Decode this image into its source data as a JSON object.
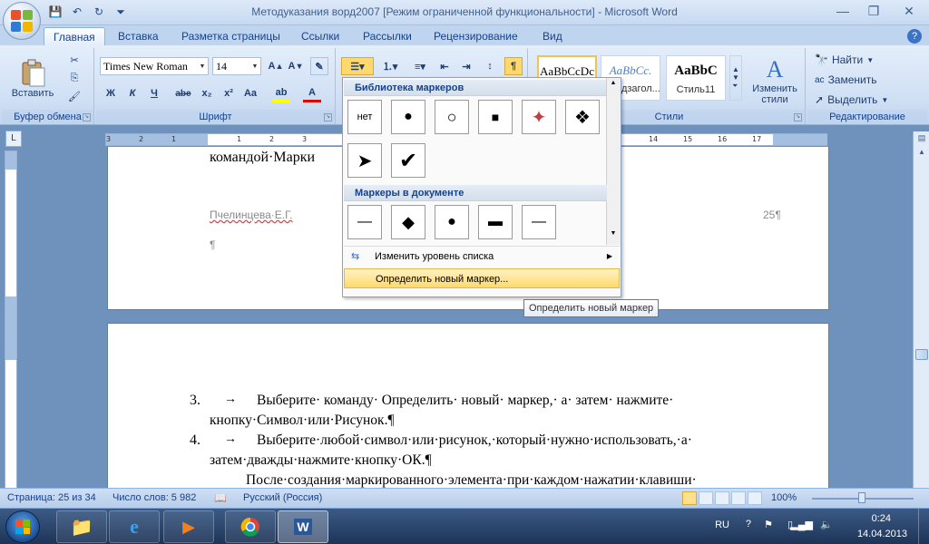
{
  "window": {
    "title": "Методуказания  ворд2007 [Режим ограниченной функциональности] - Microsoft Word"
  },
  "tabs": [
    "Главная",
    "Вставка",
    "Разметка страницы",
    "Ссылки",
    "Рассылки",
    "Рецензирование",
    "Вид"
  ],
  "ribbon": {
    "clipboard": {
      "label": "Буфер обмена",
      "paste_label": "Вставить"
    },
    "font": {
      "label": "Шрифт",
      "font_name": "Times New Roman",
      "font_size": "14",
      "bold": "Ж",
      "italic": "К",
      "underline": "Ч",
      "strike": "abe",
      "subscript": "x₂",
      "superscript": "x²",
      "case": "Aa"
    },
    "styles": {
      "label": "Стили",
      "items": [
        {
          "sample": "AaBbCcDc",
          "name": ""
        },
        {
          "sample": "AaBbCc.",
          "name": "¶ Подзагол..."
        },
        {
          "sample": "AaBbC",
          "name": "Стиль11"
        }
      ],
      "change_styles": "Изменить стили"
    },
    "editing": {
      "label": "Редактирование",
      "find": "Найти",
      "replace": "Заменить",
      "select": "Выделить"
    }
  },
  "document": {
    "page1_line": "командой·Марки",
    "author": "Пчелинцева·Е.Г.",
    "page_number": "25¶",
    "para_mark": "¶",
    "item3_num": "3.",
    "item3_line1": "Выберите· команду· Определить· новый· маркер,· а· затем· нажмите·",
    "item3_line2": "кнопку·Символ·или·Рисунок.¶",
    "item4_num": "4.",
    "item4_line1": "Выберите·любой·символ·или·рисунок,·который·нужно·использовать,·а·",
    "item4_line2": "затем·дважды·нажмите·кнопку·ОК.¶",
    "para_line": "После·создания·маркированного·элемента·при·каждом·нажатии·клавиши·"
  },
  "bullets_menu": {
    "library_title": "Библиотека маркеров",
    "library": [
      "нет",
      "●",
      "○",
      "■",
      "✦",
      "❖",
      "➤",
      "✔"
    ],
    "doc_title": "Маркеры в документе",
    "doc_bullets": [
      "—",
      "◆",
      "●",
      "▬",
      "—"
    ],
    "change_level": "Изменить уровень списка",
    "define_new": "Определить новый маркер...",
    "tooltip": "Определить новый маркер"
  },
  "status": {
    "page": "Страница: 25 из 34",
    "words": "Число слов: 5 982",
    "language": "Русский (Россия)",
    "zoom": "100%"
  },
  "taskbar": {
    "lang": "RU",
    "time": "0:24",
    "date": "14.04.2013"
  },
  "colors": {
    "accent": "#15428b",
    "ribbon": "#cfdff4",
    "highlight": "#ffd96e",
    "doc_bg": "#6f92bd"
  }
}
